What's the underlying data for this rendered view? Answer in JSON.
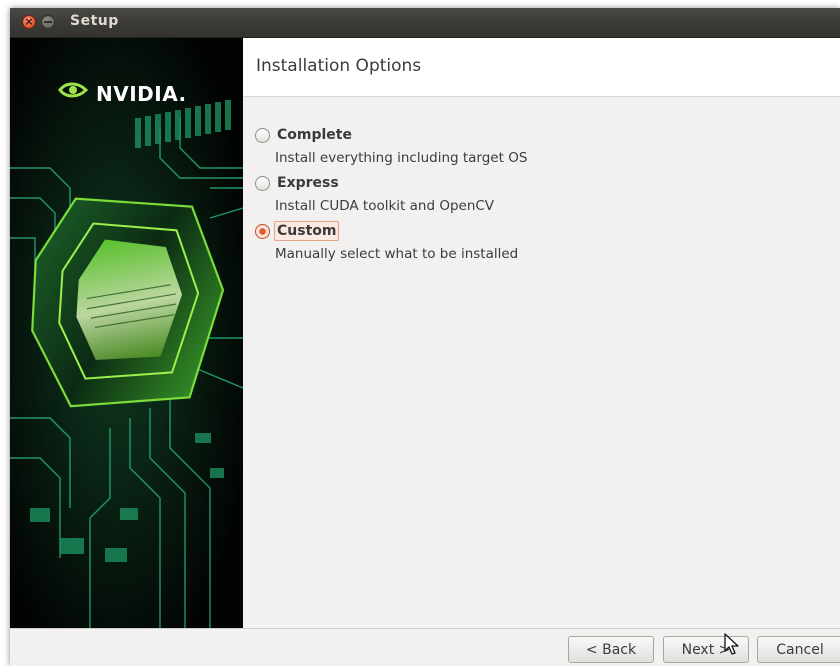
{
  "window": {
    "title": "Setup"
  },
  "banner": {
    "brand": "NVIDIA."
  },
  "header": {
    "title": "Installation Options"
  },
  "options": [
    {
      "label": "Complete",
      "description": "Install everything including target OS",
      "selected": false
    },
    {
      "label": "Express",
      "description": "Install CUDA toolkit and OpenCV",
      "selected": false
    },
    {
      "label": "Custom",
      "description": "Manually select what to be installed",
      "selected": true
    }
  ],
  "footer": {
    "back_label": "< Back",
    "next_label": "Next >",
    "cancel_label": "Cancel"
  },
  "colors": {
    "accent": "#e8582a",
    "nvidia_green": "#76b900",
    "circuit_green": "#3ddc97"
  }
}
